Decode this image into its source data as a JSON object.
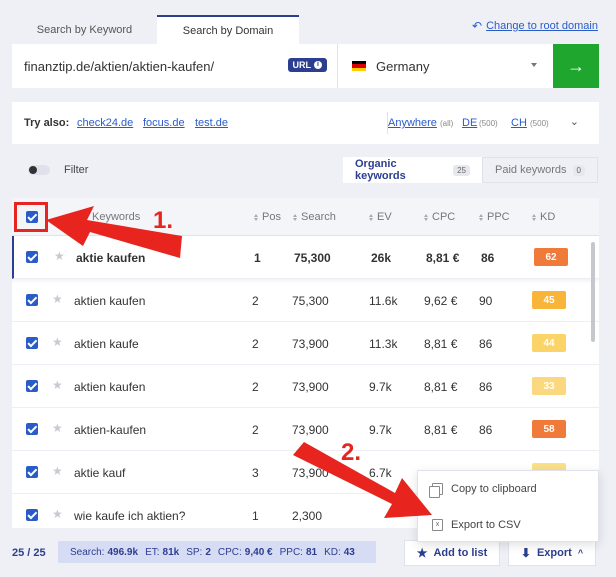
{
  "tabs": {
    "keyword": "Search by Keyword",
    "domain": "Search by Domain"
  },
  "root_link": "Change to root domain",
  "search": {
    "url": "finanztip.de/aktien/aktien-kaufen/",
    "url_badge": "URL",
    "country": "Germany",
    "go_icon": "arrow-right-icon"
  },
  "try_also": {
    "label": "Try also:",
    "links": [
      "check24.de",
      "focus.de",
      "test.de"
    ],
    "scopes": [
      {
        "label": "Anywhere",
        "sub": "(all)"
      },
      {
        "label": "DE",
        "sub": "(500)"
      },
      {
        "label": "CH",
        "sub": "(500)"
      }
    ]
  },
  "filter": {
    "label": "Filter"
  },
  "keyword_tabs": {
    "organic": {
      "label": "Organic keywords",
      "count": "25"
    },
    "paid": {
      "label": "Paid keywords",
      "count": "0"
    }
  },
  "table": {
    "headers": {
      "keyword": "Keywords",
      "pos": "Pos",
      "search": "Search",
      "ev": "EV",
      "cpc": "CPC",
      "ppc": "PPC",
      "kd": "KD"
    },
    "rows": [
      {
        "keyword": "aktie kaufen",
        "pos": "1",
        "search": "75,300",
        "ev": "26k",
        "cpc": "8,81 €",
        "ppc": "86",
        "kd": "62",
        "kd_color": "#f07a3a",
        "bold": true
      },
      {
        "keyword": "aktien kaufen",
        "pos": "2",
        "search": "75,300",
        "ev": "11.6k",
        "cpc": "9,62 €",
        "ppc": "90",
        "kd": "45",
        "kd_color": "#f9b43a",
        "bold": false
      },
      {
        "keyword": "aktien kaufe",
        "pos": "2",
        "search": "73,900",
        "ev": "11.3k",
        "cpc": "8,81 €",
        "ppc": "86",
        "kd": "44",
        "kd_color": "#fbd469",
        "bold": false
      },
      {
        "keyword": "aktien kaufen",
        "pos": "2",
        "search": "73,900",
        "ev": "9.7k",
        "cpc": "8,81 €",
        "ppc": "86",
        "kd": "33",
        "kd_color": "#fbd880",
        "bold": false
      },
      {
        "keyword": "aktien-kaufen",
        "pos": "2",
        "search": "73,900",
        "ev": "9.7k",
        "cpc": "8,81 €",
        "ppc": "86",
        "kd": "58",
        "kd_color": "#f07a3a",
        "bold": false
      },
      {
        "keyword": "aktie kauf",
        "pos": "3",
        "search": "73,900",
        "ev": "6.7k",
        "cpc": "",
        "ppc": "",
        "kd": "",
        "kd_color": "#fbe08a",
        "bold": false
      },
      {
        "keyword": "wie kaufe ich aktien?",
        "pos": "1",
        "search": "2,300",
        "ev": "",
        "cpc": "",
        "ppc": "",
        "kd": "",
        "kd_color": "",
        "bold": false
      }
    ]
  },
  "footer": {
    "count": "25 / 25",
    "metrics": [
      {
        "label": "Search:",
        "value": "496.9k"
      },
      {
        "label": "ET:",
        "value": "81k"
      },
      {
        "label": "SP:",
        "value": "2"
      },
      {
        "label": "CPC:",
        "value": "9,40 €"
      },
      {
        "label": "PPC:",
        "value": "81"
      },
      {
        "label": "KD:",
        "value": "43"
      }
    ],
    "add_to_list": "Add to list",
    "export": "Export"
  },
  "export_menu": {
    "copy": "Copy to clipboard",
    "csv": "Export to CSV"
  },
  "annotations": {
    "step1": "1.",
    "step2": "2."
  },
  "colors": {
    "accent": "#2c3e8f",
    "go_button": "#1fa62f",
    "annotation": "#e8241f"
  }
}
